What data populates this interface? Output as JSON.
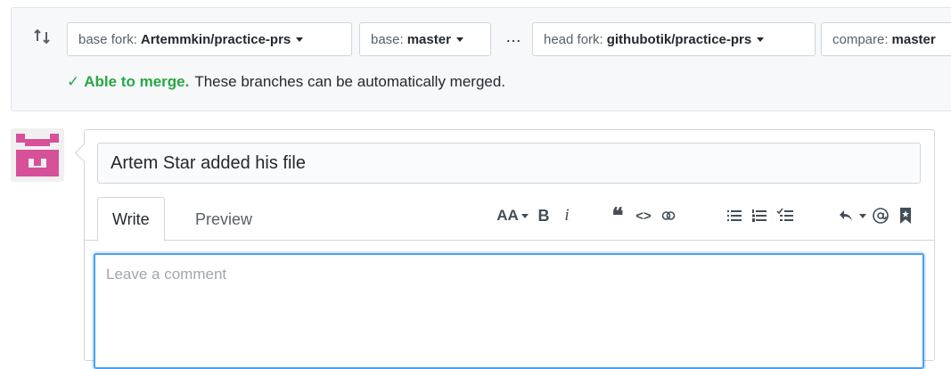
{
  "compare": {
    "base_fork": {
      "label": "base fork:",
      "value": "Artemmkin/practice-prs"
    },
    "base": {
      "label": "base:",
      "value": "master"
    },
    "ellipsis": "…",
    "head_fork": {
      "label": "head fork:",
      "value": "githubotik/practice-prs"
    },
    "compare": {
      "label": "compare:",
      "value": "master"
    },
    "merge_status": {
      "check": "✓",
      "status": "Able to merge.",
      "message": "These branches can be automatically merged."
    }
  },
  "pr": {
    "title_value": "Artem Star added his file",
    "tabs": [
      {
        "label": "Write",
        "active": true
      },
      {
        "label": "Preview",
        "active": false
      }
    ],
    "comment_placeholder": "Leave a comment"
  },
  "toolbar": {
    "heading_text": "AA",
    "bold_text": "B",
    "italic_text": "i",
    "quote_text": "❝",
    "code_text": "<>",
    "icons": [
      "text-size-icon",
      "bold-icon",
      "italic-icon",
      "quote-icon",
      "code-icon",
      "link-icon",
      "bulleted-list-icon",
      "numbered-list-icon",
      "task-list-icon",
      "reply-icon",
      "mention-icon",
      "bookmark-icon"
    ]
  },
  "colors": {
    "success": "#28a745",
    "focus_border": "#4a9ff5",
    "avatar": "#d6509a",
    "bar_bg": "#f6f8fa"
  }
}
